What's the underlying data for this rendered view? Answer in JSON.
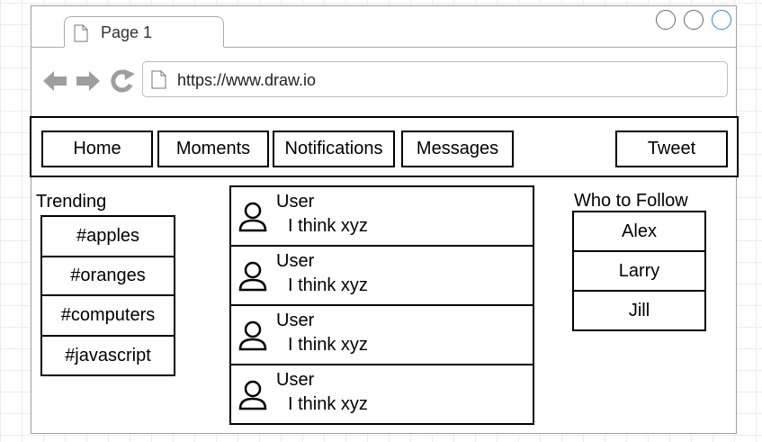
{
  "browser": {
    "tab_title": "Page 1",
    "url": "https://www.draw.io",
    "icons": [
      "page-icon",
      "back-arrow-icon",
      "forward-arrow-icon",
      "refresh-icon",
      "window-control-icon"
    ]
  },
  "nav": {
    "items": [
      "Home",
      "Moments",
      "Notifications",
      "Messages"
    ],
    "tweet_label": "Tweet"
  },
  "trending": {
    "title": "Trending",
    "items": [
      "#apples",
      "#oranges",
      "#computers",
      "#javascript"
    ]
  },
  "feed": [
    {
      "user": "User",
      "text": "I think xyz"
    },
    {
      "user": "User",
      "text": "I think xyz"
    },
    {
      "user": "User",
      "text": "I think xyz"
    },
    {
      "user": "User",
      "text": "I think xyz"
    }
  ],
  "who_to_follow": {
    "title": "Who to Follow",
    "items": [
      "Alex",
      "Larry",
      "Jill"
    ]
  },
  "colors": {
    "window_button_accent": "#1e88e5",
    "browser_chrome": "#bdbdbd"
  }
}
